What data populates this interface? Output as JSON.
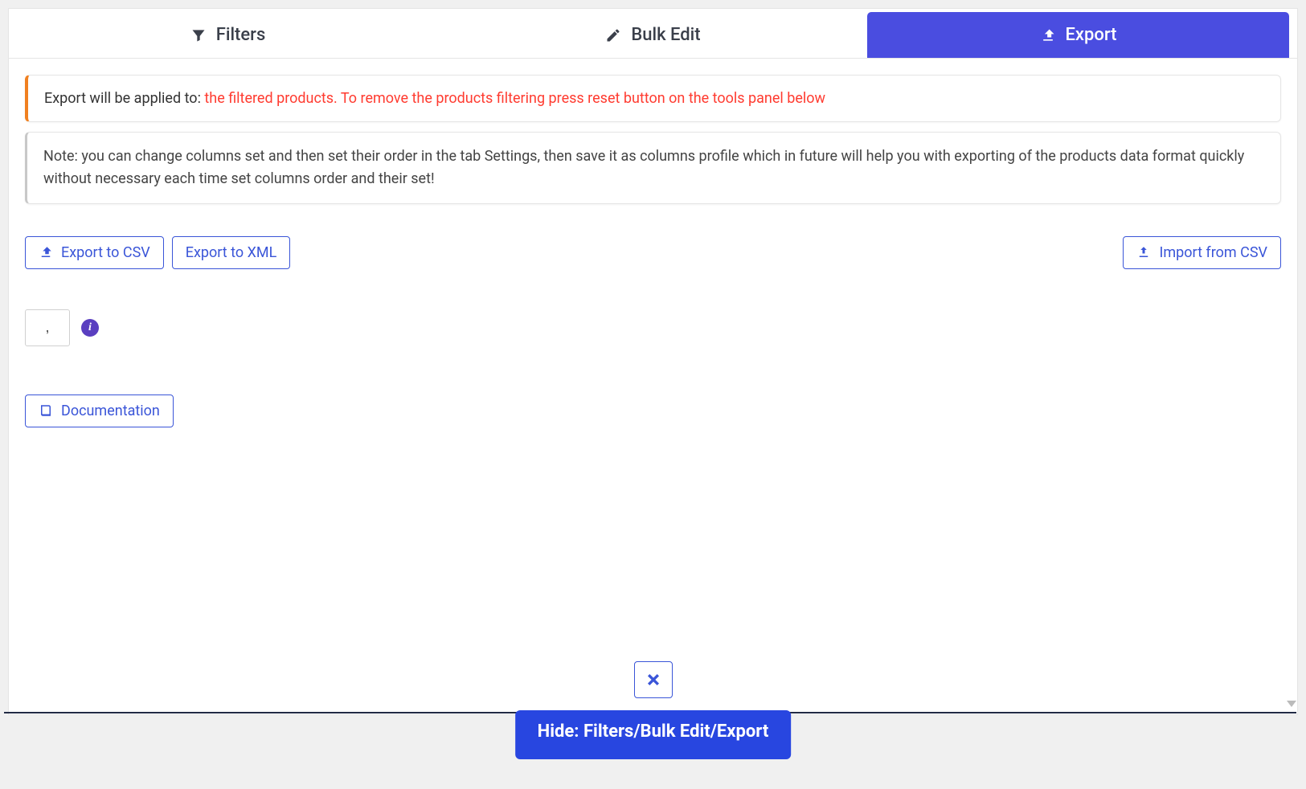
{
  "tabs": {
    "filters": "Filters",
    "bulk_edit": "Bulk Edit",
    "export": "Export"
  },
  "alerts": {
    "export_prefix": "Export will be applied to: ",
    "export_warning": "the filtered products. To remove the products filtering press reset button on the tools panel below",
    "note": "Note: you can change columns set and then set their order in the tab Settings, then save it as columns profile which in future will help you with exporting of the products data format quickly without necessary each time set columns order and their set!"
  },
  "buttons": {
    "export_csv": "Export to CSV",
    "export_xml": "Export to XML",
    "import_csv": "Import from CSV",
    "documentation": "Documentation"
  },
  "delimiter": {
    "value": ","
  },
  "footer": {
    "hide_label": "Hide: Filters/Bulk Edit/Export"
  }
}
